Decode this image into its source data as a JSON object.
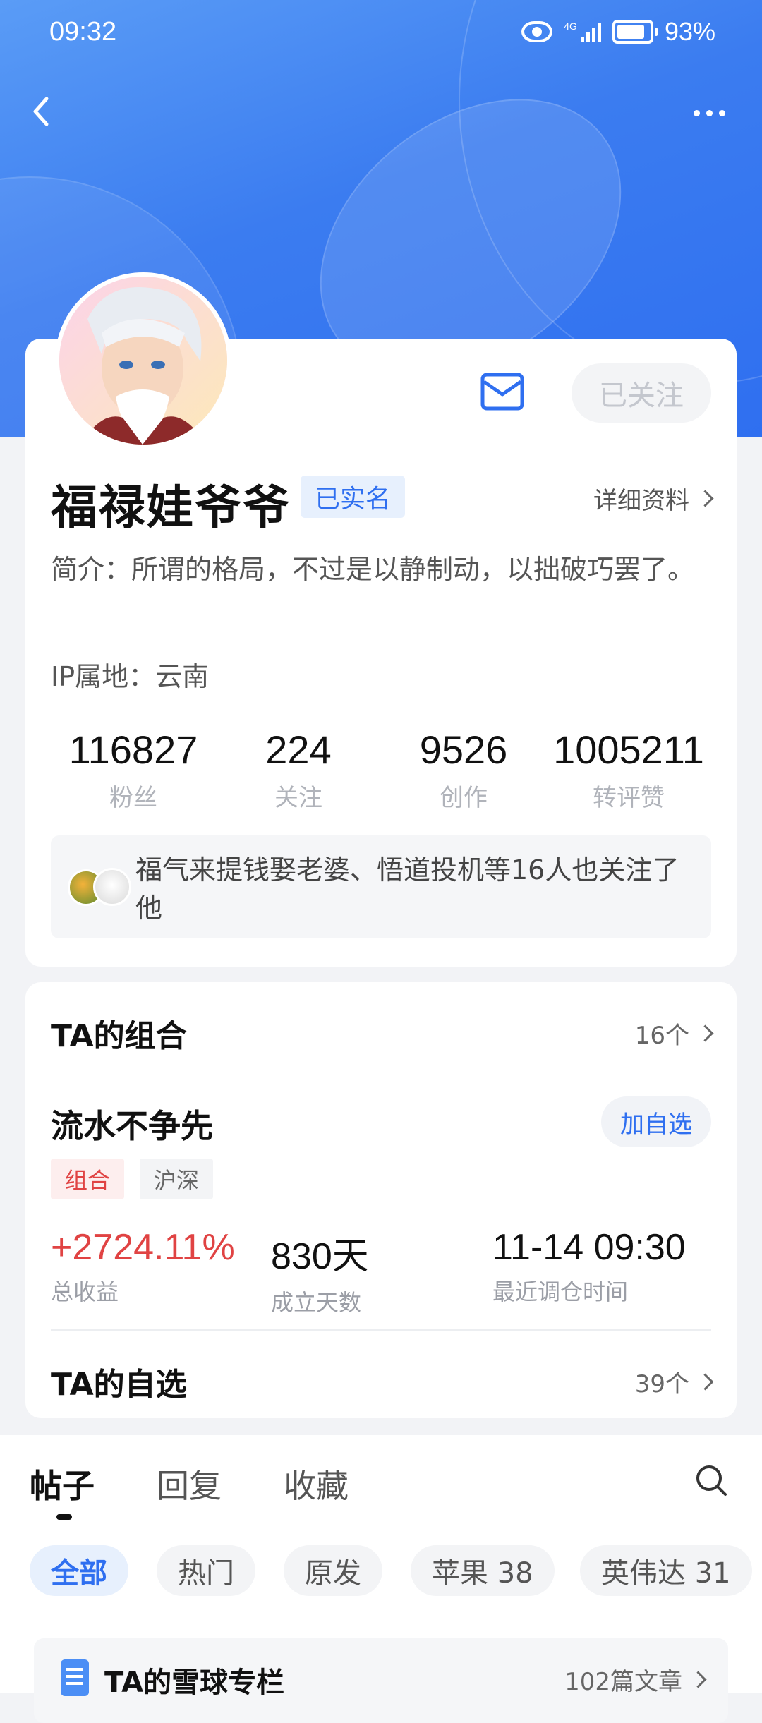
{
  "status_bar": {
    "time": "09:32",
    "network": "4G",
    "battery": "93%"
  },
  "profile": {
    "follow_state": "已关注",
    "name": "福禄娃爷爷",
    "verified_badge": "已实名",
    "detail_link": "详细资料",
    "bio": "简介：所谓的格局，不过是以静制动，以拙破巧罢了。",
    "ip": "IP属地：云南",
    "stats": [
      {
        "value": "116827",
        "label": "粉丝"
      },
      {
        "value": "224",
        "label": "关注"
      },
      {
        "value": "9526",
        "label": "创作"
      },
      {
        "value": "1005211",
        "label": "转评赞"
      }
    ],
    "mutual_follow": "福气来提钱娶老婆、悟道投机等16人也关注了他"
  },
  "portfolio": {
    "section_title": "TA的组合",
    "count": "16个",
    "name": "流水不争先",
    "add_button": "加自选",
    "tags": [
      "组合",
      "沪深"
    ],
    "total_return": "+2724.11%",
    "total_return_label": "总收益",
    "days": "830天",
    "days_label": "成立天数",
    "last_rebalance": "11-14 09:30",
    "last_rebalance_label": "最近调仓时间"
  },
  "watchlist": {
    "section_title": "TA的自选",
    "count": "39个"
  },
  "tabs": [
    "帖子",
    "回复",
    "收藏"
  ],
  "filters": [
    "全部",
    "热门",
    "原发",
    "苹果 38",
    "英伟达 31"
  ],
  "column": {
    "title": "TA的雪球专栏",
    "count": "102篇文章"
  },
  "colors": {
    "accent": "#2f6ff0",
    "red": "#e04343"
  }
}
